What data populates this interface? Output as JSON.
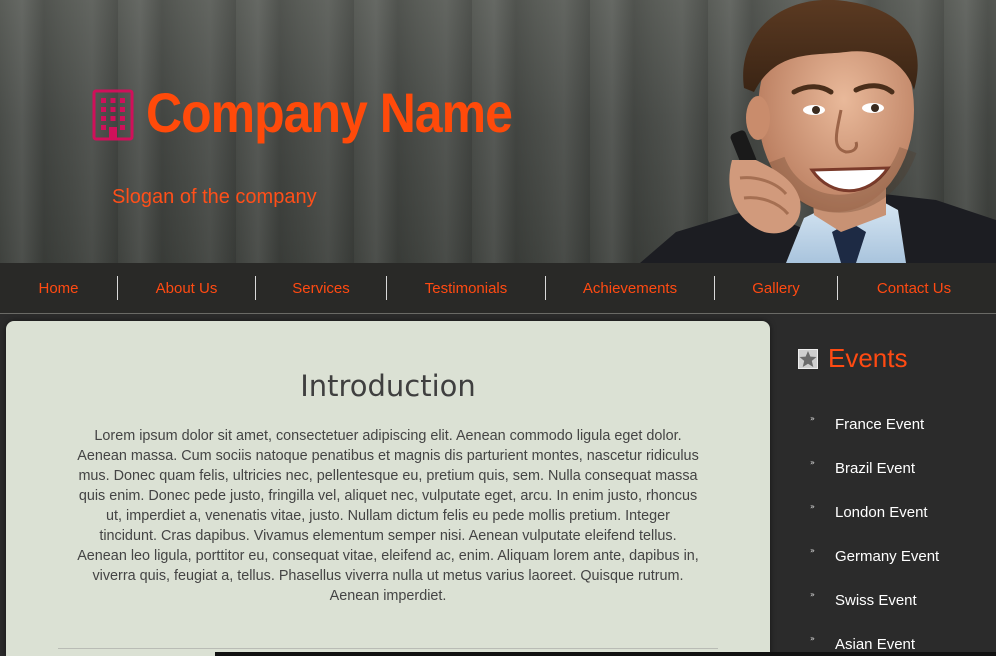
{
  "header": {
    "company_name": "Company Name",
    "slogan": "Slogan of the company",
    "brand_color": "#ff4a0a",
    "logo_icon": "building-icon"
  },
  "nav": {
    "items": [
      {
        "label": "Home"
      },
      {
        "label": "About Us"
      },
      {
        "label": "Services"
      },
      {
        "label": "Testimonials"
      },
      {
        "label": "Achievements"
      },
      {
        "label": "Gallery"
      },
      {
        "label": "Contact Us"
      }
    ]
  },
  "main": {
    "title": "Introduction",
    "body": "Lorem ipsum dolor sit amet, consectetuer adipiscing elit. Aenean commodo ligula eget dolor. Aenean massa. Cum sociis natoque penatibus et magnis dis parturient montes, nascetur ridiculus mus. Donec quam felis, ultricies nec, pellentesque eu, pretium quis, sem. Nulla consequat massa quis enim. Donec pede justo, fringilla vel, aliquet nec, vulputate eget, arcu. In enim justo, rhoncus ut, imperdiet a, venenatis vitae, justo. Nullam dictum felis eu pede mollis pretium. Integer tincidunt. Cras dapibus. Vivamus elementum semper nisi. Aenean vulputate eleifend tellus. Aenean leo ligula, porttitor eu, consequat vitae, eleifend ac, enim. Aliquam lorem ante, dapibus in, viverra quis, feugiat a, tellus. Phasellus viverra nulla ut metus varius laoreet. Quisque rutrum. Aenean imperdiet."
  },
  "sidebar": {
    "title": "Events",
    "title_icon": "star-badge-icon",
    "events": [
      {
        "label": "France Event"
      },
      {
        "label": "Brazil Event"
      },
      {
        "label": "London Event"
      },
      {
        "label": "Germany Event"
      },
      {
        "label": "Swiss Event"
      },
      {
        "label": "Asian Event"
      }
    ]
  }
}
